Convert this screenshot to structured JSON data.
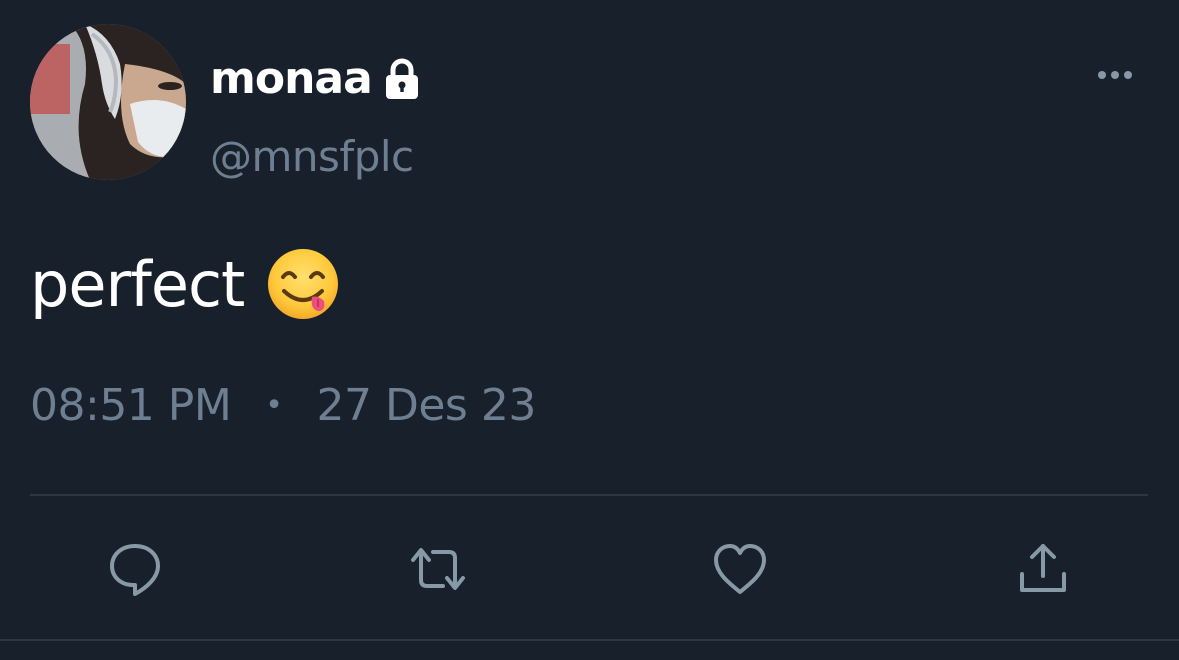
{
  "tweet": {
    "display_name": "monaa",
    "handle": "@mnsfplc",
    "text": "perfect",
    "emoji": "face-savoring-food",
    "time": "08:51 PM",
    "separator": "•",
    "date": "27 Des 23"
  },
  "icons": {
    "lock": "lock-icon",
    "more": "more-horizontal-icon",
    "reply": "reply-icon",
    "retweet": "retweet-icon",
    "like": "heart-icon",
    "share": "share-icon"
  },
  "colors": {
    "background": "#17202b",
    "primary_text": "#ffffff",
    "secondary_text": "#6f7f92",
    "divider": "#2c3743",
    "icon": "#8899a6"
  }
}
